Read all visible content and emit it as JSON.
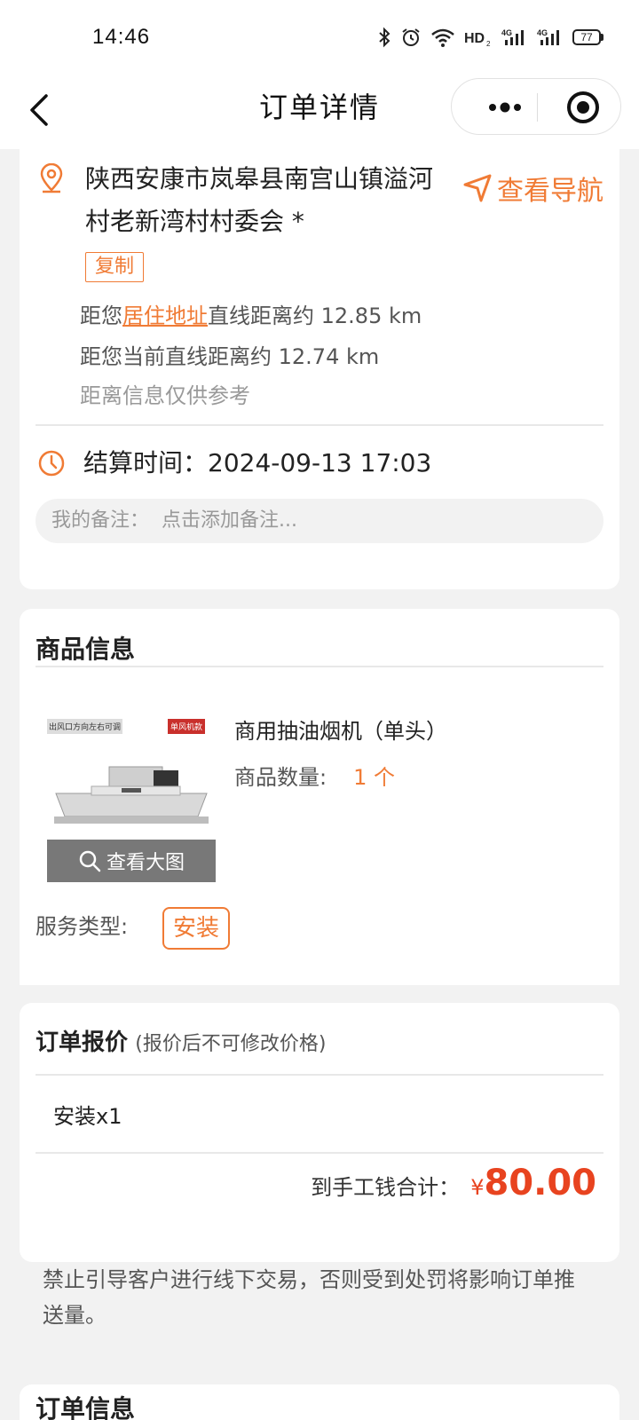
{
  "status": {
    "time": "14:46",
    "battery": "77"
  },
  "nav": {
    "title": "订单详情"
  },
  "address": {
    "text": "陕西安康市岚皋县南宫山镇溢河村老新湾村村委会 *",
    "nav_label": "查看导航",
    "copy_label": "复制",
    "distance_home_prefix": "距您",
    "distance_home_link": "居住地址",
    "distance_home_suffix": "直线距离约 12.85 km",
    "distance_current": "距您当前直线距离约 12.74 km",
    "distance_note": "距离信息仅供参考"
  },
  "settlement": {
    "label": "结算时间：2024-09-13 17:03"
  },
  "remark": {
    "label": "我的备注：",
    "placeholder": "点击添加备注..."
  },
  "product": {
    "section_title": "商品信息",
    "image_label_left": "出风口方向左右可调",
    "image_label_right": "单风机款",
    "view_large": "查看大图",
    "name": "商用抽油烟机（单头）",
    "qty_label": "商品数量:",
    "qty_value": "1 个",
    "service_label": "服务类型:",
    "service_value": "安装"
  },
  "quote": {
    "title": "订单报价",
    "note": "(报价后不可修改价格)",
    "line_item": "安装x1",
    "total_label": "到手工钱合计：",
    "currency": "¥",
    "total_amount": "80.00"
  },
  "warning": "禁止引导客户进行线下交易，否则受到处罚将影响订单推送量。",
  "order_info": {
    "title": "订单信息"
  },
  "colors": {
    "accent": "#f07b35",
    "price": "#e8431f"
  }
}
